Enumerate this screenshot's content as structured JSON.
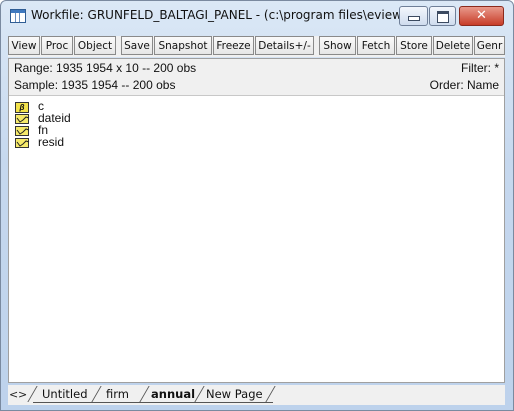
{
  "window": {
    "title": "Workfile: GRUNFELD_BALTAGI_PANEL - (c:\\program files\\eviews ...",
    "close_glyph": "✕"
  },
  "toolbar": {
    "buttons": [
      "View",
      "Proc",
      "Object",
      "Save",
      "Snapshot",
      "Freeze",
      "Details+/-",
      "Show",
      "Fetch",
      "Store",
      "Delete",
      "Genr"
    ]
  },
  "info": {
    "range": "Range:  1935 1954 x 10  --  200 obs",
    "filter": "Filter: *",
    "sample": "Sample: 1935 1954  --  200 obs",
    "order": "Order: Name"
  },
  "objects": [
    {
      "name": "c",
      "icon": "coef-vector-icon",
      "glyph": "β"
    },
    {
      "name": "dateid",
      "icon": "series-icon"
    },
    {
      "name": "fn",
      "icon": "series-icon"
    },
    {
      "name": "resid",
      "icon": "series-icon"
    }
  ],
  "tabs": {
    "nav_left": "<",
    "nav_right": ">",
    "items": [
      "Untitled",
      "firm",
      "annual",
      "New Page"
    ],
    "active": "annual"
  }
}
